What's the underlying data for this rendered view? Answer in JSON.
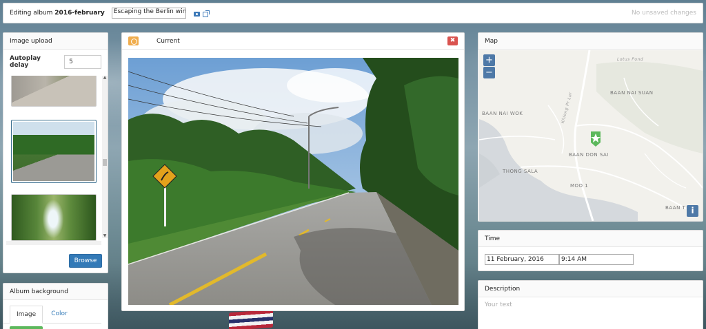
{
  "topbar": {
    "editing_prefix": "Editing album",
    "album_name": "2016-february",
    "title_value": "Escaping the Berlin wint",
    "status": "No unsaved changes"
  },
  "upload": {
    "title": "Image upload",
    "autoplay_label": "Autoplay delay",
    "autoplay_value": "5",
    "browse_label": "Browse",
    "scroll_up": "▲",
    "scroll_down": "▼",
    "scroll_left": "◀"
  },
  "album_background": {
    "title": "Album background",
    "tabs": [
      "Image",
      "Color"
    ]
  },
  "current": {
    "title": "Current",
    "close_glyph": "✖"
  },
  "map": {
    "title": "Map",
    "zoom_in": "+",
    "zoom_out": "−",
    "info": "i",
    "labels": {
      "lotus_pond": "Lotus Pond",
      "baan_nai_suan": "BAAN NAI SUAN",
      "baan_nai_wok": "BAAN NAI WOK",
      "khlong_pr_lor": "Khlong Pr Lor",
      "thong_sala": "THONG SALA",
      "baan_don_sai": "BAAN DON SAI",
      "moo_1": "MOO 1",
      "baan_t": "BAAN T"
    },
    "marker_icon": "star-marker-icon",
    "accent": "#5cb85c"
  },
  "time": {
    "title": "Time",
    "date_value": "11 February, 2016",
    "time_value": "9:14 AM"
  },
  "description": {
    "title": "Description",
    "placeholder": "Your text"
  },
  "colors": {
    "primary": "#337ab7",
    "warning": "#f0ad4e",
    "danger": "#d9534f",
    "success": "#5cb85c"
  }
}
